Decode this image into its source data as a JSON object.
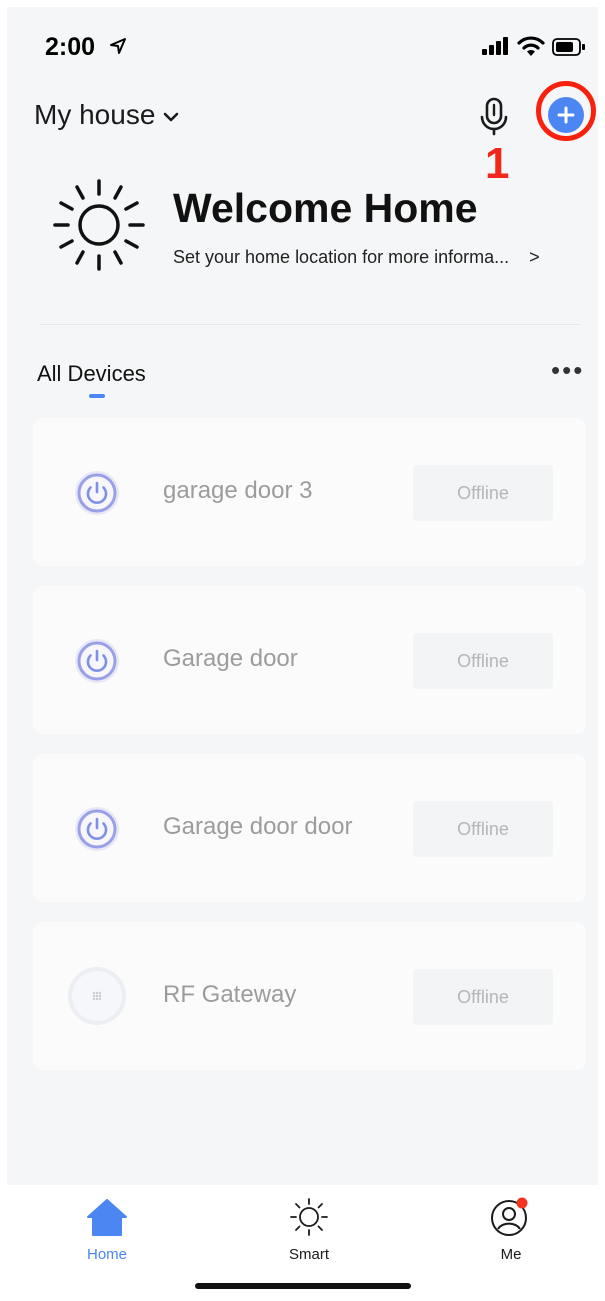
{
  "status_bar": {
    "time": "2:00"
  },
  "header": {
    "home_name": "My house",
    "annotation_number": "1"
  },
  "welcome": {
    "title": "Welcome Home",
    "subtitle": "Set your home location for more informa...",
    "chevron": ">"
  },
  "devices_section": {
    "tab_label": "All Devices",
    "more_label": "•••"
  },
  "devices": [
    {
      "name": "garage door 3",
      "status": "Offline",
      "icon": "power-icon"
    },
    {
      "name": "Garage door",
      "status": "Offline",
      "icon": "power-icon"
    },
    {
      "name": "Garage door door",
      "status": "Offline",
      "icon": "power-icon"
    },
    {
      "name": "RF Gateway",
      "status": "Offline",
      "icon": "gateway-icon"
    }
  ],
  "tabbar": {
    "items": [
      {
        "label": "Home",
        "icon": "home-icon",
        "active": true
      },
      {
        "label": "Smart",
        "icon": "sun-icon",
        "active": false
      },
      {
        "label": "Me",
        "icon": "user-icon",
        "active": false
      }
    ]
  },
  "colors": {
    "accent": "#4b86f3",
    "annotation_red": "#f0271a",
    "badge_red": "#f5341f"
  }
}
